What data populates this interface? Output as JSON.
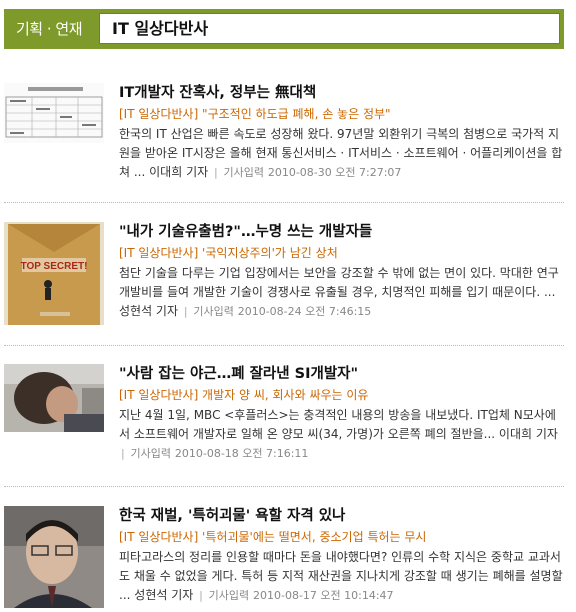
{
  "header": {
    "section": "기획 · 연재",
    "series_title": "IT 일상다반사"
  },
  "articles": [
    {
      "title": "IT개발자 잔혹사, 정부는 無대책",
      "subline": "[IT 일상다반사] \"구조적인 하도급 폐해, 손 놓은 정부\"",
      "summary": "한국의 IT 산업은 빠른 속도로 성장해 왔다. 97년말 외환위기 극복의 첨병으로 국가적 지원을 받아온 IT시장은 올해 현재 통신서비스 · IT서비스 · 소프트웨어 · 어플리케이션을 합쳐 ...",
      "author": "이대희 기자",
      "date_label": "기사입력",
      "date": "2010-08-30 오전 7:27:07",
      "thumbnail": "table-document-thumbnail"
    },
    {
      "title": "\"내가 기술유출범?\"…누명 쓰는 개발자들",
      "subline": "[IT 일상다반사] '국익지상주의'가 남긴 상처",
      "summary": "첨단 기술을 다루는 기업 입장에서는 보안을 강조할 수 밖에 없는 면이 있다. 막대한 연구개발비를 들여 개발한 기술이 경쟁사로 유출될 경우, 치명적인 피해를 입기 때문이다. ...",
      "author": "성현석 기자",
      "date_label": "기사입력",
      "date": "2010-08-24 오전 7:46:15",
      "thumbnail": "top-secret-envelope-thumbnail",
      "thumbnail_text": "TOP SECRET!"
    },
    {
      "title": "\"사람 잡는 야근…폐 잘라낸 SI개발자\"",
      "subline": "[IT 일상다반사] 개발자 양 씨, 회사와 싸우는 이유",
      "summary": "지난 4월 1일, MBC <후플러스>는 충격적인 내용의 방송을 내보냈다. IT업체 N모사에서 소프트웨어 개발자로 일해 온 양모 씨(34, 가명)가 오른쪽 폐의 절반을... 이대희 기자",
      "author": "",
      "date_label": "기사입력",
      "date": "2010-08-18 오전 7:16:11",
      "thumbnail": "person-photo-thumbnail"
    },
    {
      "title": "한국 재벌, '특허괴물' 욕할 자격 있나",
      "subline": "[IT 일상다반사] '특허괴물'에는 떨면서, 중소기업 특허는 무시",
      "summary": "피타고라스의 정리를 인용할 때마다 돈을 내야했다면? 인류의 수학 지식은 중학교 교과서도 채울 수 없었을 게다. 특허 등 지적 재산권을 지나치게 강조할 때 생기는 폐해를 설명할 ...",
      "author": "성현석 기자",
      "date_label": "기사입력",
      "date": "2010-08-17 오전 10:14:47",
      "thumbnail": "man-portrait-thumbnail"
    }
  ],
  "colors": {
    "header_green": "#7d9a2a",
    "subline_orange": "#cc6600"
  }
}
